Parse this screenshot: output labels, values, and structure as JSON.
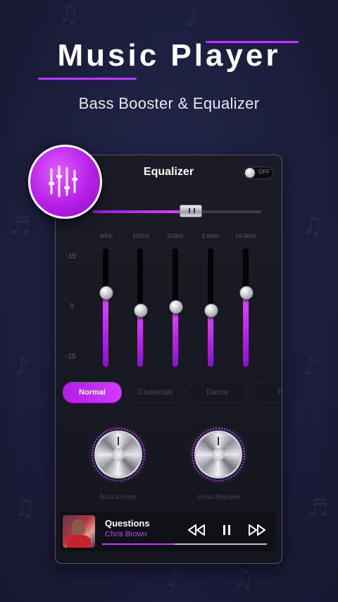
{
  "header": {
    "title": "Music Player",
    "subtitle": "Bass Booster & Equalizer"
  },
  "equalizer": {
    "title": "Equalizer",
    "toggle": {
      "label": "OFF",
      "state": "off"
    },
    "balance_level": 0.58,
    "freq_labels": [
      "60Hz",
      "230Hz",
      "910Hz",
      "3.6kHz",
      "14.0kHz"
    ],
    "db_labels": [
      "15",
      "0",
      "-15"
    ],
    "bands": [
      {
        "freq": "60Hz",
        "level": 0.63
      },
      {
        "freq": "230Hz",
        "level": 0.48
      },
      {
        "freq": "910Hz",
        "level": 0.51
      },
      {
        "freq": "3.6kHz",
        "level": 0.48
      },
      {
        "freq": "14.0kHz",
        "level": 0.63
      }
    ],
    "presets": [
      "Normal",
      "Classicale",
      "Dance",
      "Fl"
    ],
    "active_preset": "Normal",
    "knobs": {
      "bass_label": "Bass Booster",
      "virtual_label": "Virtual Machine"
    }
  },
  "player": {
    "song_title": "Questions",
    "artist": "Chris Brown",
    "progress": 0.44,
    "controls": [
      "rewind-icon",
      "pause-icon",
      "fast-forward-icon"
    ]
  },
  "colors": {
    "accent": "#c33dff",
    "background": "#1c1e3d",
    "panel": "#17181f"
  }
}
